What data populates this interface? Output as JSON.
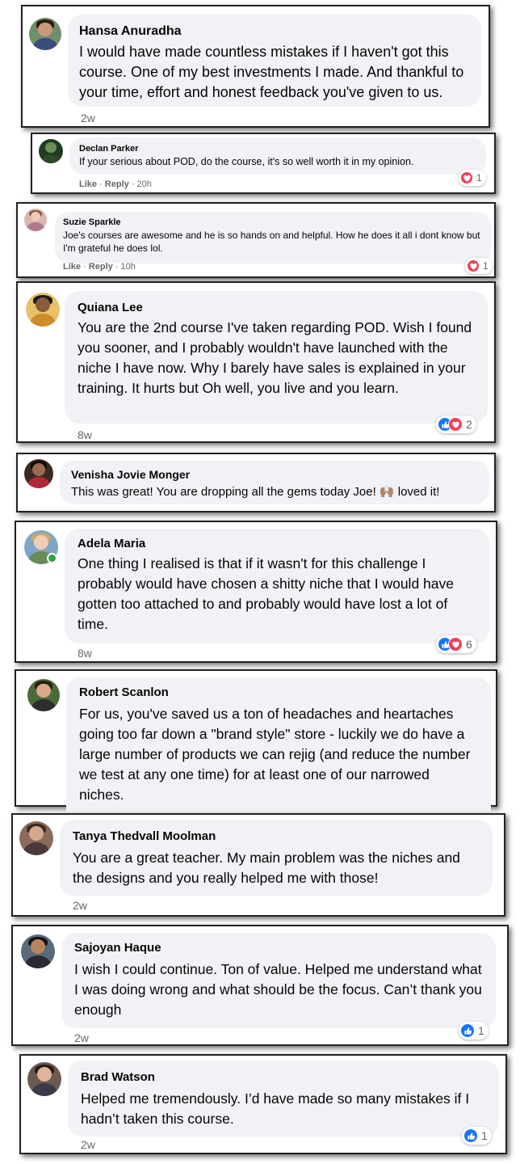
{
  "comments": [
    {
      "name": "Hansa Anuradha",
      "text": "I would have made countless mistakes if I haven't got this course. One of my best investments I made. And thankful to your time, effort and honest feedback you've given to us.",
      "time": "2w"
    },
    {
      "name": "Declan Parker",
      "text": "If your serious about POD, do the course, it's so well worth it in my opinion.",
      "like": "Like",
      "reply": "Reply",
      "time": "20h",
      "reaction_count": "1"
    },
    {
      "name": "Suzie Sparkle",
      "text": "Joe's courses are awesome and he is so hands on and helpful. How he does it all i dont know but I'm grateful he does lol.",
      "like": "Like",
      "reply": "Reply",
      "time": "10h",
      "reaction_count": "1"
    },
    {
      "name": "Quiana Lee",
      "text": "You are the 2nd course I've taken regarding POD. Wish I found you sooner, and I probably wouldn't have launched with the niche I have now. Why I barely have sales is explained in your training. It hurts but Oh well, you live and you learn.",
      "time": "8w",
      "reaction_count": "2"
    },
    {
      "name": "Venisha Jovie Monger",
      "text": "This was great! You are dropping all the gems today Joe! 🙌🏽 loved it!"
    },
    {
      "name": "Adela Maria",
      "text": "One thing I realised is that if it wasn't for this challenge I probably would have chosen a shitty niche that I would have gotten too attached to and probably would have lost a lot of time.",
      "time": "8w",
      "reaction_count": "6"
    },
    {
      "name": "Robert Scanlon",
      "text": "For us, you've saved us a ton of headaches and heartaches going too far down a \"brand style\" store - luckily we do have a large number of products we can rejig (and reduce the number we test at any one time) for at least one of our narrowed niches."
    },
    {
      "name": "Tanya Thedvall Moolman",
      "text": "You are a great teacher. My main problem was the niches and the designs and you really helped me with those!",
      "time": "2w"
    },
    {
      "name": "Sajoyan Haque",
      "text": "I wish I could continue. Ton of value. Helped me understand what I was doing wrong and what should be the focus. Can’t thank you enough",
      "time": "2w",
      "reaction_count": "1"
    },
    {
      "name": "Brad Watson",
      "text": "Helped me tremendously. I’d have made so many mistakes if I hadn’t taken this course.",
      "time": "2w",
      "reaction_count": "1"
    }
  ],
  "colors": {
    "like_blue": "#1877f2",
    "love_red": "#f33e58",
    "bubble_gray": "#f0f2f5",
    "meta_gray": "#65676b",
    "online_green": "#31a24c"
  }
}
